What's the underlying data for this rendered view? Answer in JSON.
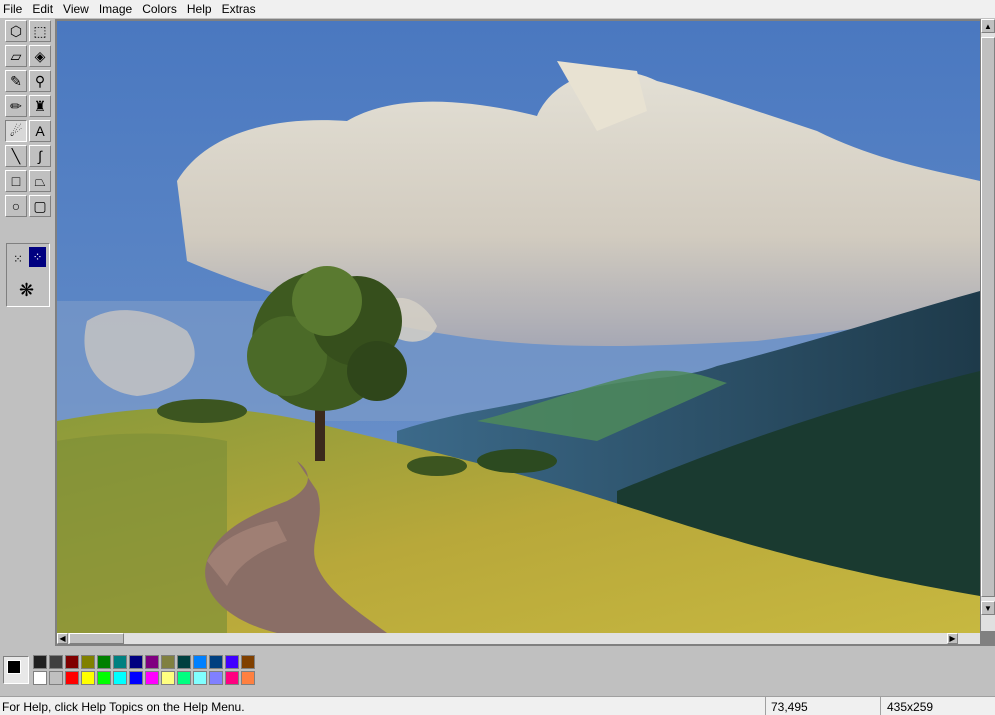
{
  "menu": {
    "items": [
      "File",
      "Edit",
      "View",
      "Image",
      "Colors",
      "Help",
      "Extras"
    ]
  },
  "toolbox": {
    "tools": [
      {
        "name": "free-select",
        "glyph": "⬡"
      },
      {
        "name": "rect-select",
        "glyph": "⬚"
      },
      {
        "name": "eraser",
        "glyph": "▱"
      },
      {
        "name": "fill",
        "glyph": "◈"
      },
      {
        "name": "color-picker",
        "glyph": "✎"
      },
      {
        "name": "magnifier",
        "glyph": "⚲"
      },
      {
        "name": "pencil",
        "glyph": "✏"
      },
      {
        "name": "brush",
        "glyph": "♜"
      },
      {
        "name": "airbrush",
        "glyph": "☄"
      },
      {
        "name": "text",
        "glyph": "A"
      },
      {
        "name": "line",
        "glyph": "╲"
      },
      {
        "name": "curve",
        "glyph": "∫"
      },
      {
        "name": "rectangle",
        "glyph": "□"
      },
      {
        "name": "polygon",
        "glyph": "⏢"
      },
      {
        "name": "ellipse",
        "glyph": "○"
      },
      {
        "name": "rounded-rect",
        "glyph": "▢"
      }
    ],
    "active_tool": "airbrush"
  },
  "palette": {
    "foreground": "#000000",
    "background": "#5b89b5",
    "row1": [
      "#202020",
      "#404040",
      "#800000",
      "#808000",
      "#008000",
      "#008080",
      "#000080",
      "#800080",
      "#808040",
      "#004040",
      "#0080ff",
      "#004080",
      "#4000ff",
      "#804000"
    ],
    "row2": [
      "#ffffff",
      "#c0c0c0",
      "#ff0000",
      "#ffff00",
      "#00ff00",
      "#00ffff",
      "#0000ff",
      "#ff00ff",
      "#ffff80",
      "#00ff80",
      "#80ffff",
      "#8080ff",
      "#ff0080",
      "#ff8040"
    ]
  },
  "status": {
    "help_text": "For Help, click Help Topics on the Help Menu.",
    "cursor_pos": "73,495",
    "selection_size": "435x259"
  }
}
